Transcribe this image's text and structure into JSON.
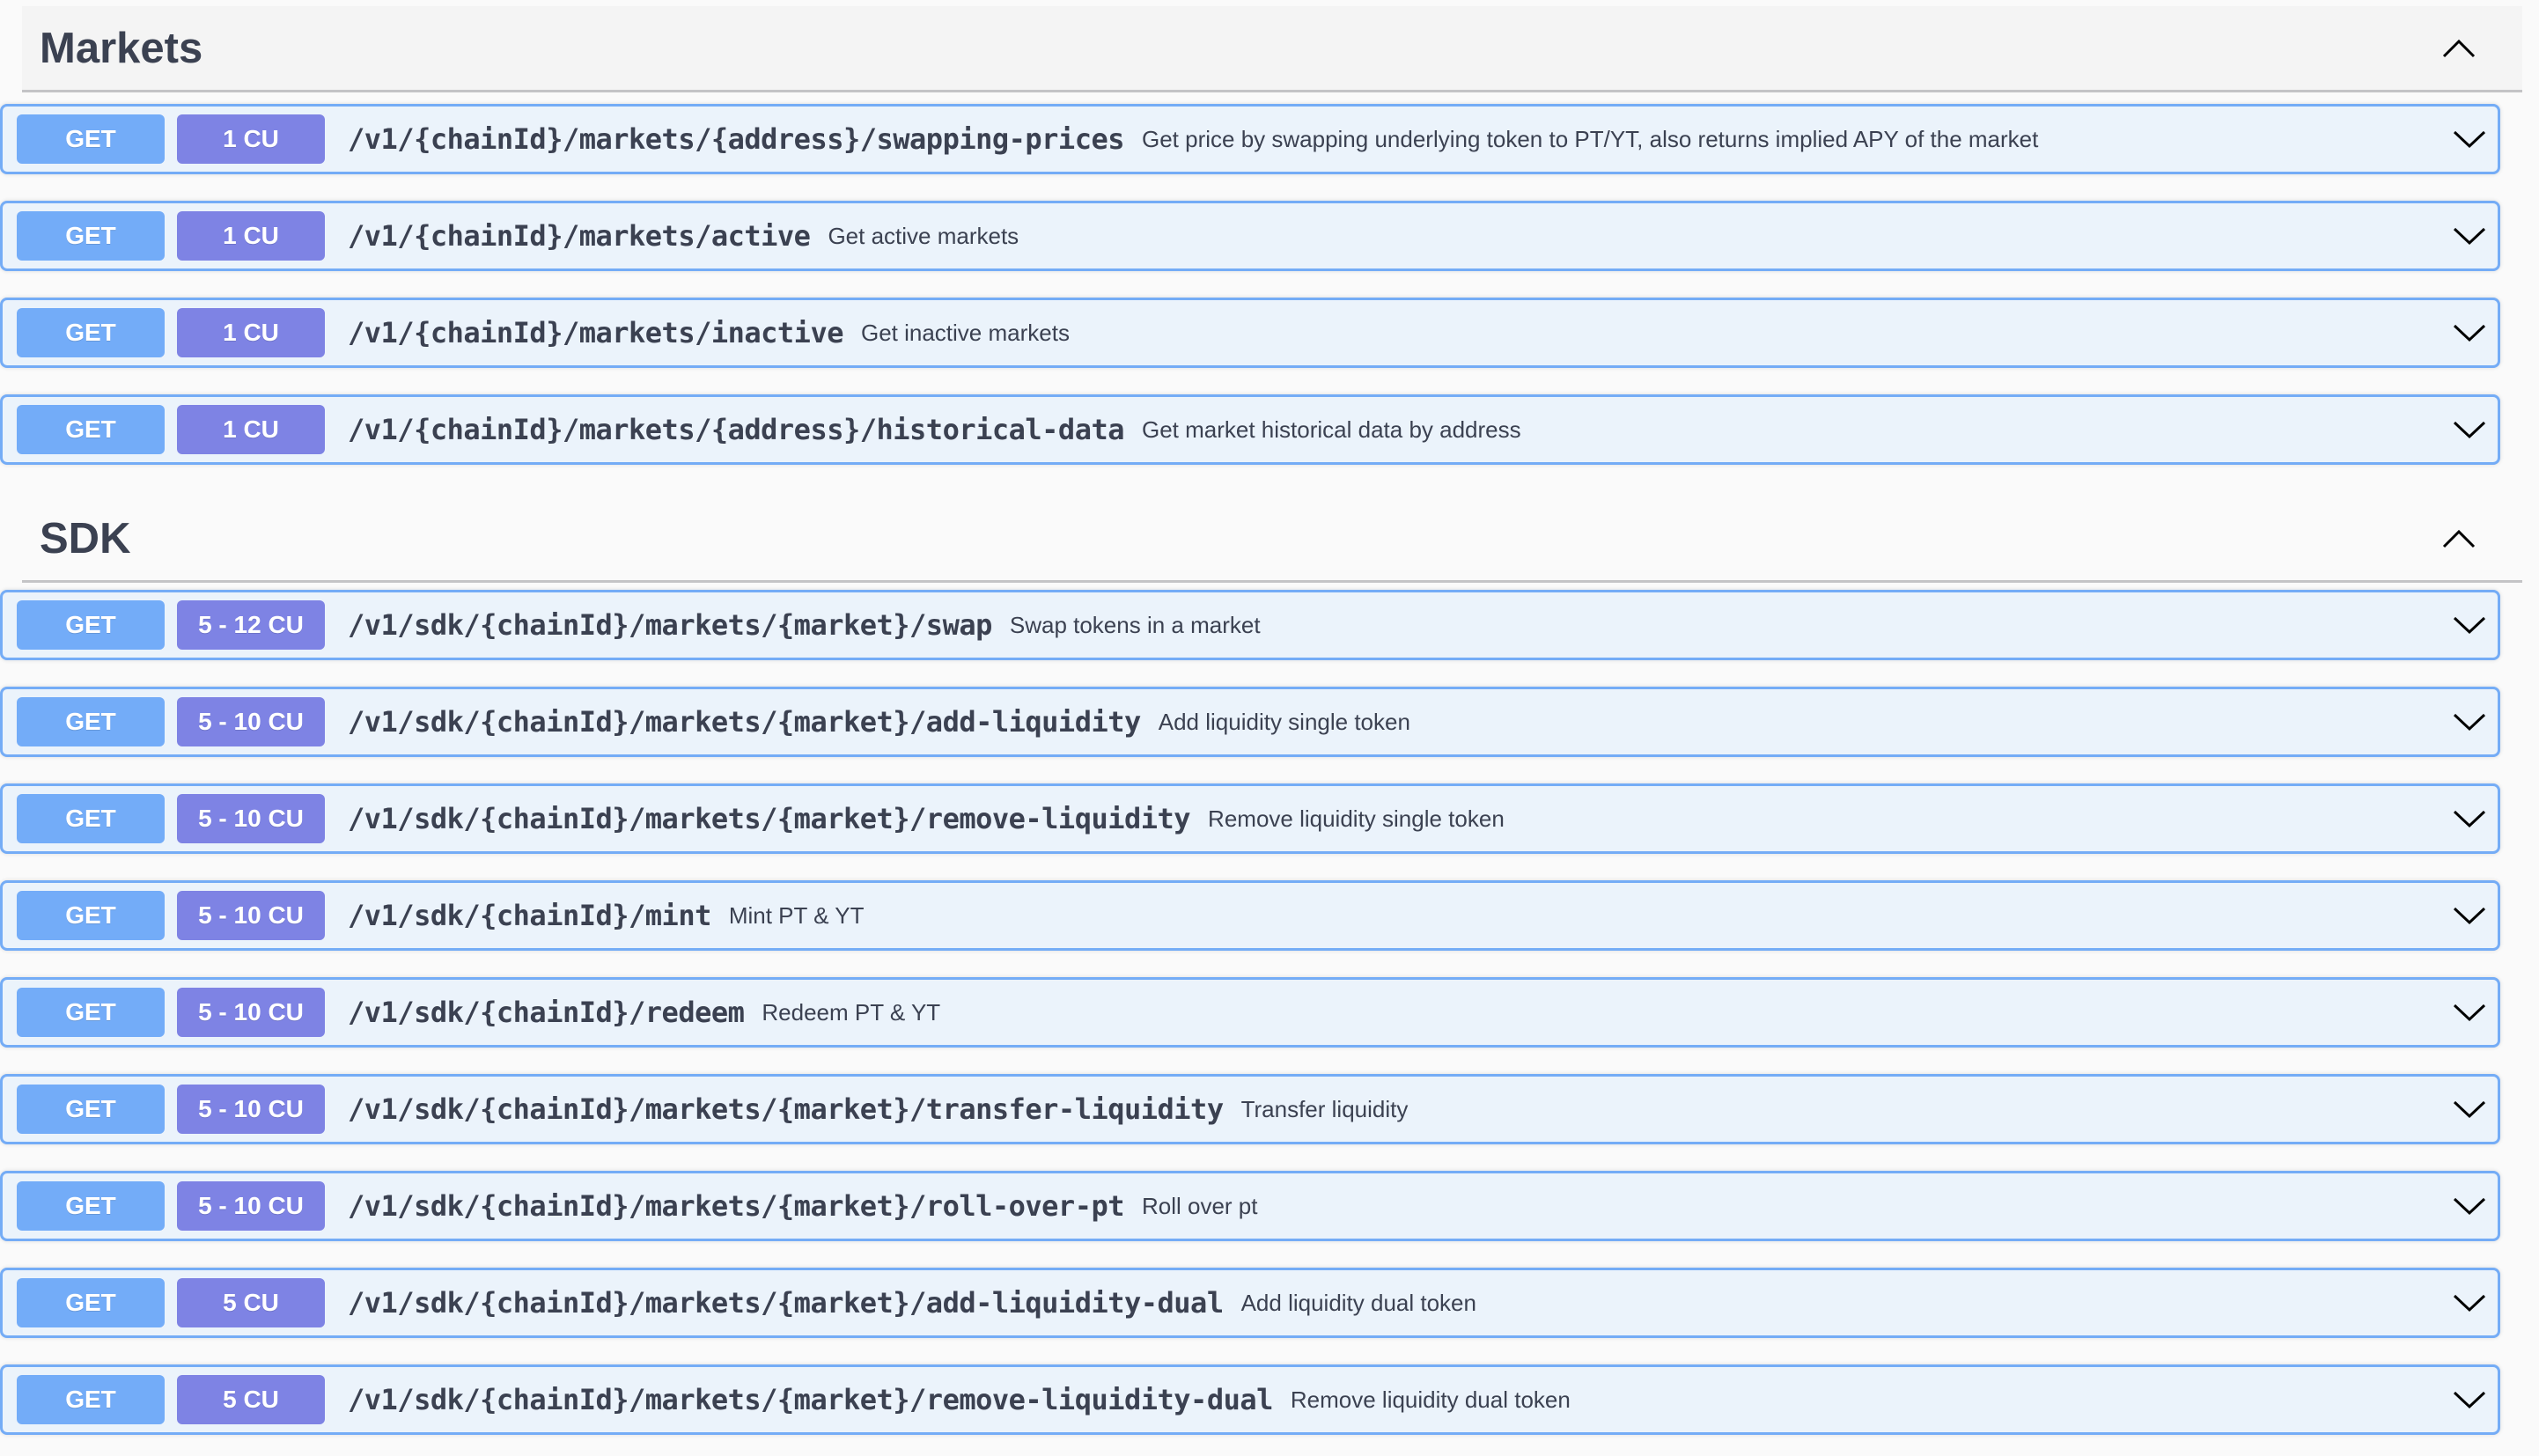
{
  "sections": [
    {
      "title": "Markets",
      "collapse_icon": "chevron-up-icon",
      "operations": [
        {
          "method": "GET",
          "cost": "1 CU",
          "path": "/v1/{chainId}/markets/{address}/swapping-prices",
          "description": "Get price by swapping underlying token to PT/YT, also returns implied APY of the market"
        },
        {
          "method": "GET",
          "cost": "1 CU",
          "path": "/v1/{chainId}/markets/active",
          "description": "Get active markets"
        },
        {
          "method": "GET",
          "cost": "1 CU",
          "path": "/v1/{chainId}/markets/inactive",
          "description": "Get inactive markets"
        },
        {
          "method": "GET",
          "cost": "1 CU",
          "path": "/v1/{chainId}/markets/{address}/historical-data",
          "description": "Get market historical data by address"
        }
      ]
    },
    {
      "title": "SDK",
      "collapse_icon": "chevron-up-icon",
      "operations": [
        {
          "method": "GET",
          "cost": "5 - 12 CU",
          "path": "/v1/sdk/{chainId}/markets/{market}/swap",
          "description": "Swap tokens in a market"
        },
        {
          "method": "GET",
          "cost": "5 - 10 CU",
          "path": "/v1/sdk/{chainId}/markets/{market}/add-liquidity",
          "description": "Add liquidity single token"
        },
        {
          "method": "GET",
          "cost": "5 - 10 CU",
          "path": "/v1/sdk/{chainId}/markets/{market}/remove-liquidity",
          "description": "Remove liquidity single token"
        },
        {
          "method": "GET",
          "cost": "5 - 10 CU",
          "path": "/v1/sdk/{chainId}/mint",
          "description": "Mint PT & YT"
        },
        {
          "method": "GET",
          "cost": "5 - 10 CU",
          "path": "/v1/sdk/{chainId}/redeem",
          "description": "Redeem PT & YT"
        },
        {
          "method": "GET",
          "cost": "5 - 10 CU",
          "path": "/v1/sdk/{chainId}/markets/{market}/transfer-liquidity",
          "description": "Transfer liquidity"
        },
        {
          "method": "GET",
          "cost": "5 - 10 CU",
          "path": "/v1/sdk/{chainId}/markets/{market}/roll-over-pt",
          "description": "Roll over pt"
        },
        {
          "method": "GET",
          "cost": "5 CU",
          "path": "/v1/sdk/{chainId}/markets/{market}/add-liquidity-dual",
          "description": "Add liquidity dual token"
        },
        {
          "method": "GET",
          "cost": "5 CU",
          "path": "/v1/sdk/{chainId}/markets/{market}/remove-liquidity-dual",
          "description": "Remove liquidity dual token"
        }
      ]
    }
  ],
  "colors": {
    "method_get": "#73acf8",
    "cost_badge": "#7e83e4",
    "op_background": "#ebf3fb",
    "op_border": "#74acf6",
    "text": "#3b4151"
  }
}
